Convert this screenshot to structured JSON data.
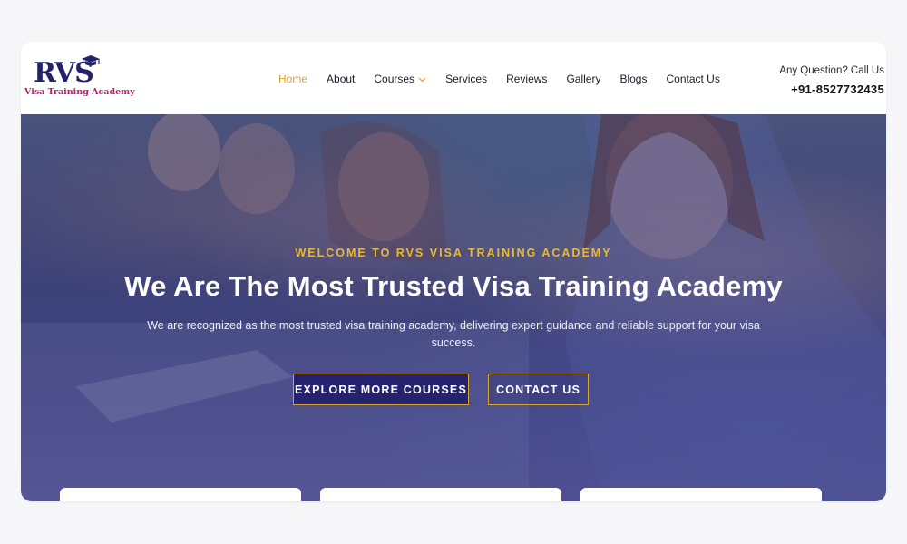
{
  "logo": {
    "mark": "RVS",
    "tagline": "Visa Training Academy",
    "colors": {
      "mark": "#24226b",
      "tagline": "#c8176b"
    }
  },
  "nav": {
    "items": [
      {
        "label": "Home",
        "active": true
      },
      {
        "label": "About",
        "active": false
      },
      {
        "label": "Courses",
        "active": false,
        "has_dropdown": true
      },
      {
        "label": "Services",
        "active": false
      },
      {
        "label": "Reviews",
        "active": false
      },
      {
        "label": "Gallery",
        "active": false
      },
      {
        "label": "Blogs",
        "active": false
      },
      {
        "label": "Contact Us",
        "active": false
      }
    ],
    "active_color": "#d9a436"
  },
  "contact": {
    "question": "Any Question? Call Us",
    "phone": "+91-8527732435"
  },
  "hero": {
    "eyebrow": "WELCOME TO RVS VISA TRAINING ACADEMY",
    "title": "We Are The Most Trusted Visa Training Academy",
    "description": "We are recognized as the most trusted visa training academy, delivering expert guidance and reliable support for your visa success.",
    "buttons": {
      "primary": "EXPLORE MORE COURSES",
      "secondary": "CONTACT US"
    },
    "colors": {
      "eyebrow": "#e8b83c",
      "button_bg": "#25236d",
      "button_border": "#d9a436"
    }
  },
  "icons": [
    "graduation-cap-icon",
    "chevron-down-icon"
  ]
}
